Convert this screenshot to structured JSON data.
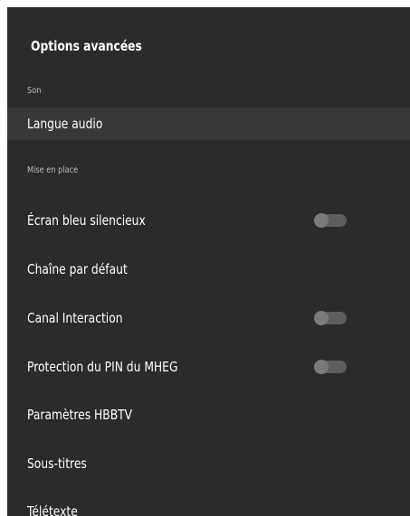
{
  "header": {
    "title": "Options avancées"
  },
  "sections": {
    "son": "Son",
    "mise_en_place": "Mise en place"
  },
  "items": [
    {
      "label": "Langue audio",
      "selected": true
    },
    {
      "label": "Écran bleu silencieux",
      "toggle": false
    },
    {
      "label": "Chaîne par défaut"
    },
    {
      "label": "Canal Interaction",
      "toggle": false
    },
    {
      "label": "Protection du PIN du MHEG",
      "toggle": false
    },
    {
      "label": "Paramètres HBBTV"
    },
    {
      "label": "Sous-titres"
    },
    {
      "label": "Télétexte"
    }
  ]
}
